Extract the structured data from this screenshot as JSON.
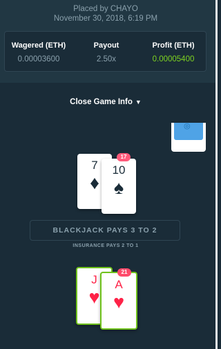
{
  "header": {
    "placed_by": "Placed by CHAYO",
    "date": "November 30, 2018, 6:19 PM"
  },
  "stats": {
    "wagered_label": "Wagered (ETH)",
    "wagered_value": "0.00003600",
    "payout_label": "Payout",
    "payout_value": "2.50x",
    "profit_label": "Profit (ETH)",
    "profit_value": "0.00005400"
  },
  "close_info": "Close Game Info",
  "dealer": {
    "total": "17",
    "cards": [
      {
        "rank": "7",
        "suit": "♦"
      },
      {
        "rank": "10",
        "suit": "♠"
      }
    ]
  },
  "table": {
    "blackjack_text": "BLACKJACK PAYS 3 TO 2",
    "insurance_text": "INSURANCE PAYS 2 TO 1"
  },
  "player": {
    "total": "21",
    "cards": [
      {
        "rank": "J",
        "suit": "♥"
      },
      {
        "rank": "A",
        "suit": "♥"
      }
    ]
  },
  "colors": {
    "background": "#1a2c38",
    "panel": "#213743",
    "profit": "#7ed321",
    "win_border": "#6fc21b",
    "badge": "#fe5a7a",
    "red_suit": "#fe2247"
  }
}
